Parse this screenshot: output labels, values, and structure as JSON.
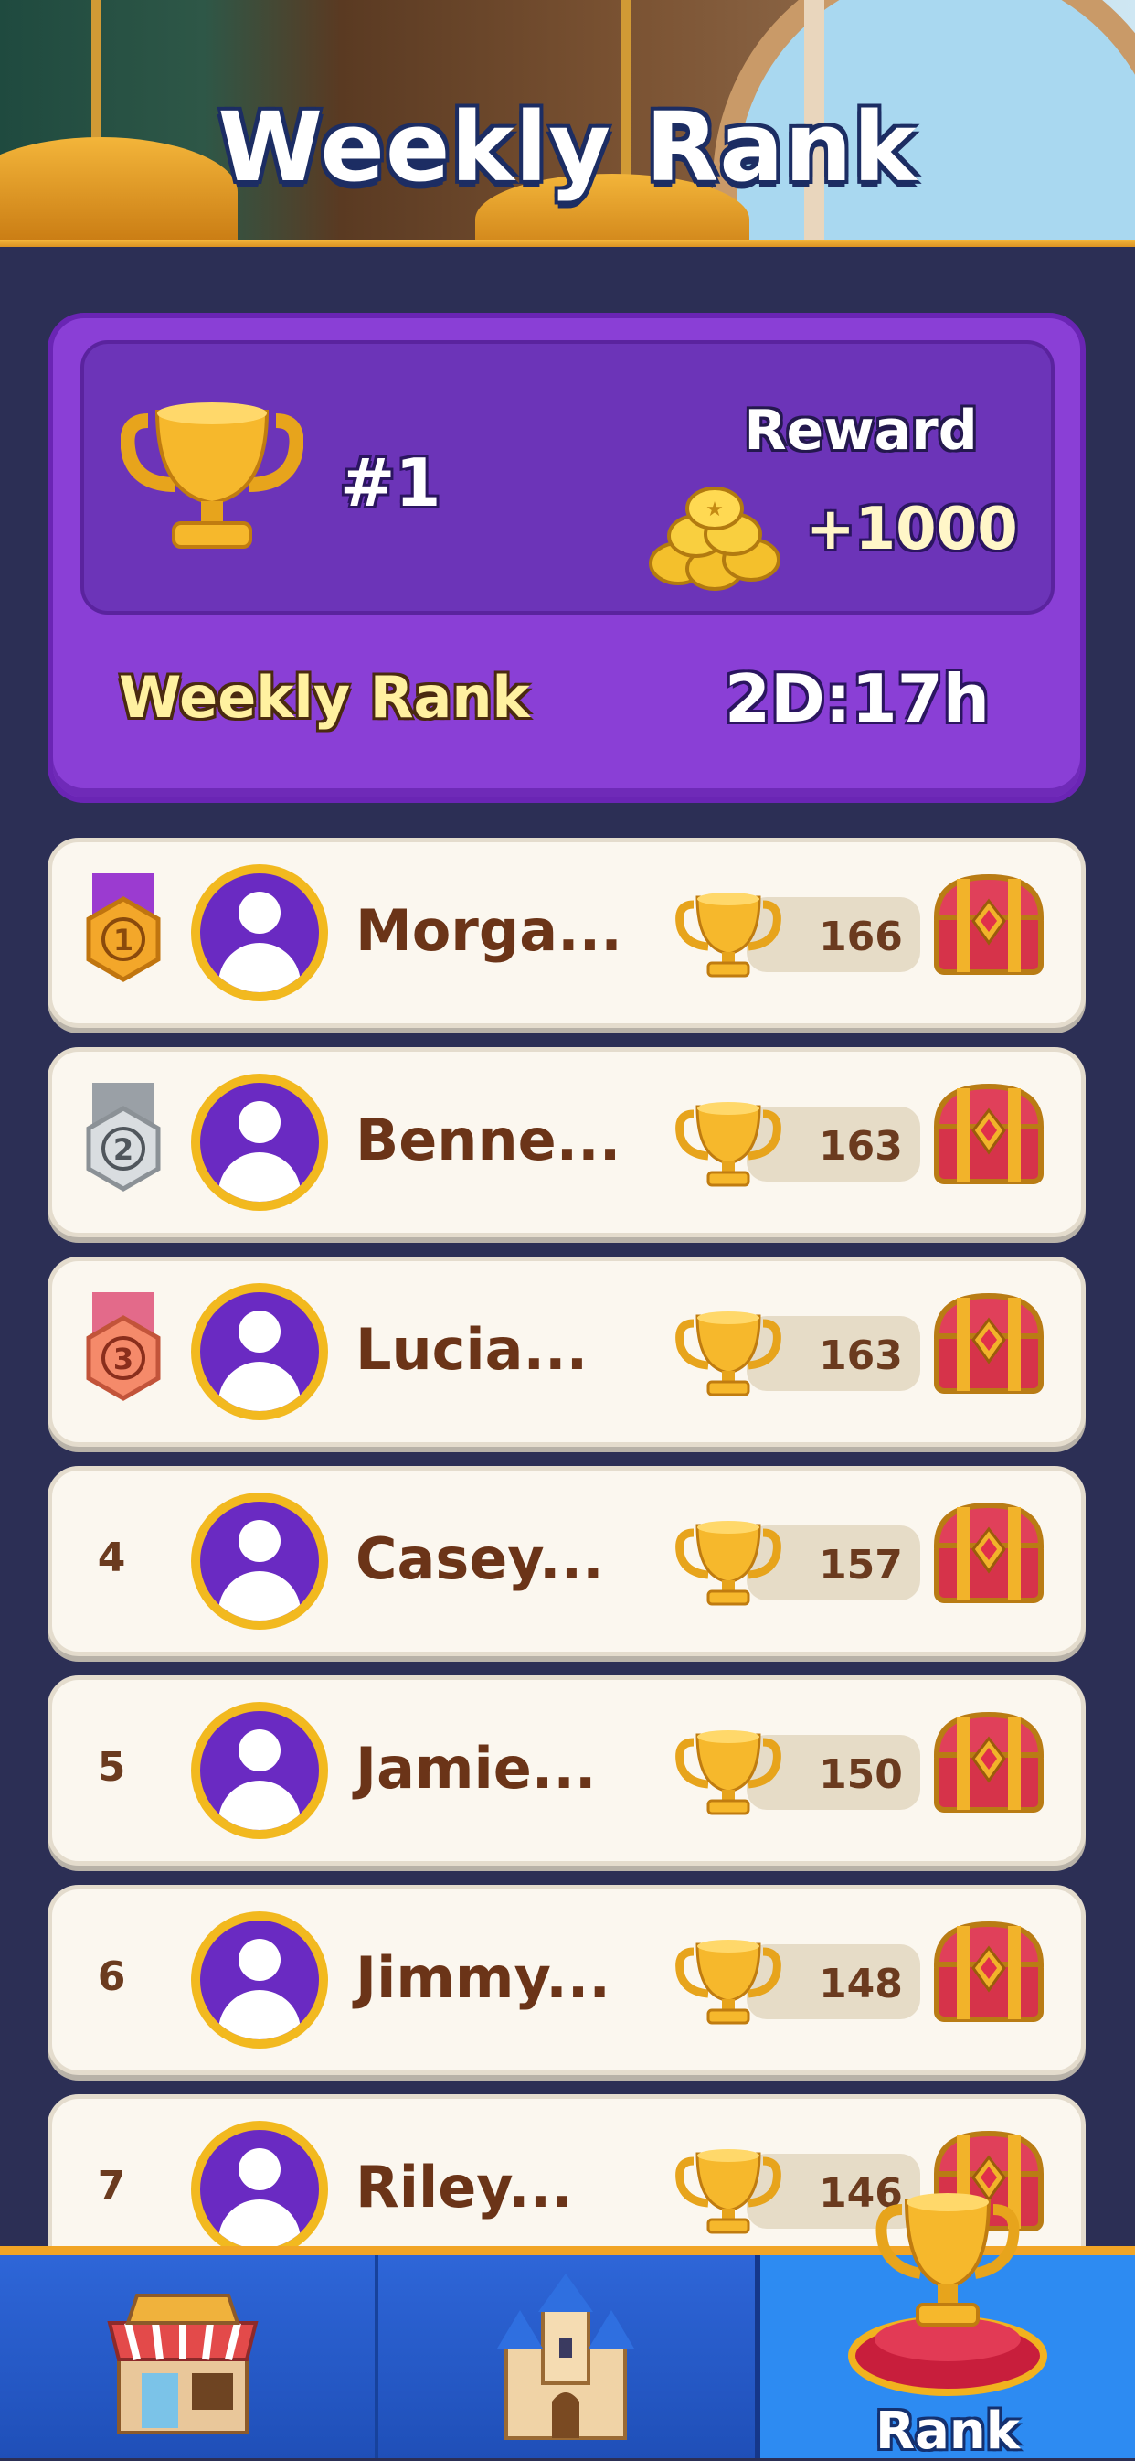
{
  "header": {
    "title": "Weekly Rank"
  },
  "summary": {
    "my_rank": "#1",
    "reward_label": "Reward",
    "reward_amount": "+1000",
    "card_title": "Weekly Rank",
    "countdown": "2D:17h"
  },
  "leaderboard": [
    {
      "rank": "1",
      "name": "Morga...",
      "score": "166",
      "medal": "gold"
    },
    {
      "rank": "2",
      "name": "Benne...",
      "score": "163",
      "medal": "silver"
    },
    {
      "rank": "3",
      "name": "Lucia...",
      "score": "163",
      "medal": "bronze"
    },
    {
      "rank": "4",
      "name": "Casey...",
      "score": "157",
      "medal": "none"
    },
    {
      "rank": "5",
      "name": "Jamie...",
      "score": "150",
      "medal": "none"
    },
    {
      "rank": "6",
      "name": "Jimmy...",
      "score": "148",
      "medal": "none"
    },
    {
      "rank": "7",
      "name": "Riley...",
      "score": "146",
      "medal": "none"
    }
  ],
  "bottom_nav": {
    "tabs": [
      {
        "icon": "shop-icon",
        "label": ""
      },
      {
        "icon": "castle-icon",
        "label": ""
      },
      {
        "icon": "rank-trophy-icon",
        "label": "Rank",
        "active": true
      }
    ]
  },
  "colors": {
    "card_purple": "#8a3fd6",
    "avatar_purple": "#6a2ac2",
    "gold": "#f2b91f",
    "nav_blue": "#2e66d8",
    "background": "#2c2f55"
  }
}
